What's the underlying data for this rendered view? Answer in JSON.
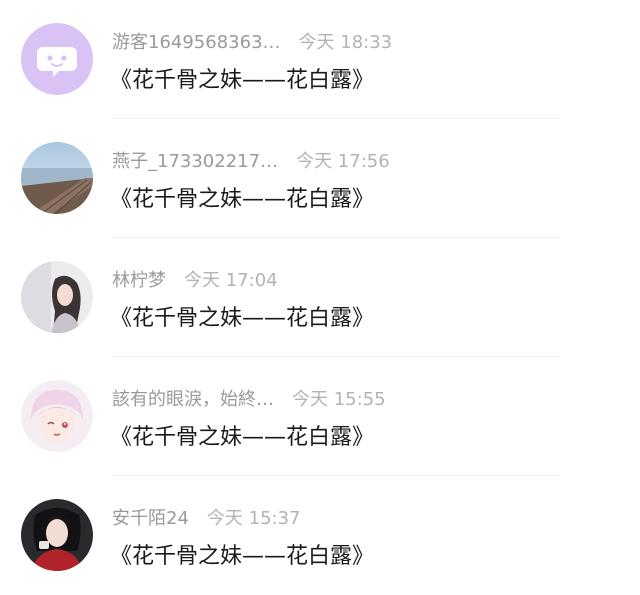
{
  "messages": [
    {
      "name": "游客1649568363…",
      "time": "今天 18:33",
      "text": "《花千骨之妹——花白露》",
      "avatar": "default-chat-avatar-icon"
    },
    {
      "name": "燕子_173302217…",
      "time": "今天 17:56",
      "text": "《花千骨之妹——花白露》",
      "avatar": "pier-photo-avatar"
    },
    {
      "name": "林柠梦",
      "time": "今天 17:04",
      "text": "《花千骨之妹——花白露》",
      "avatar": "girl-photo-avatar"
    },
    {
      "name": "該有的眼淚，始終…",
      "time": "今天 15:55",
      "text": "《花千骨之妹——花白露》",
      "avatar": "anime-girl-avatar"
    },
    {
      "name": "安千陌24",
      "time": "今天 15:37",
      "text": "《花千骨之妹——花白露》",
      "avatar": "costume-woman-avatar"
    }
  ],
  "colors": {
    "default_avatar_bg": "#d9c3f5",
    "name_gray": "#9a9a9a",
    "time_gray": "#b3b3b3",
    "message_text": "#1a1a1a"
  }
}
